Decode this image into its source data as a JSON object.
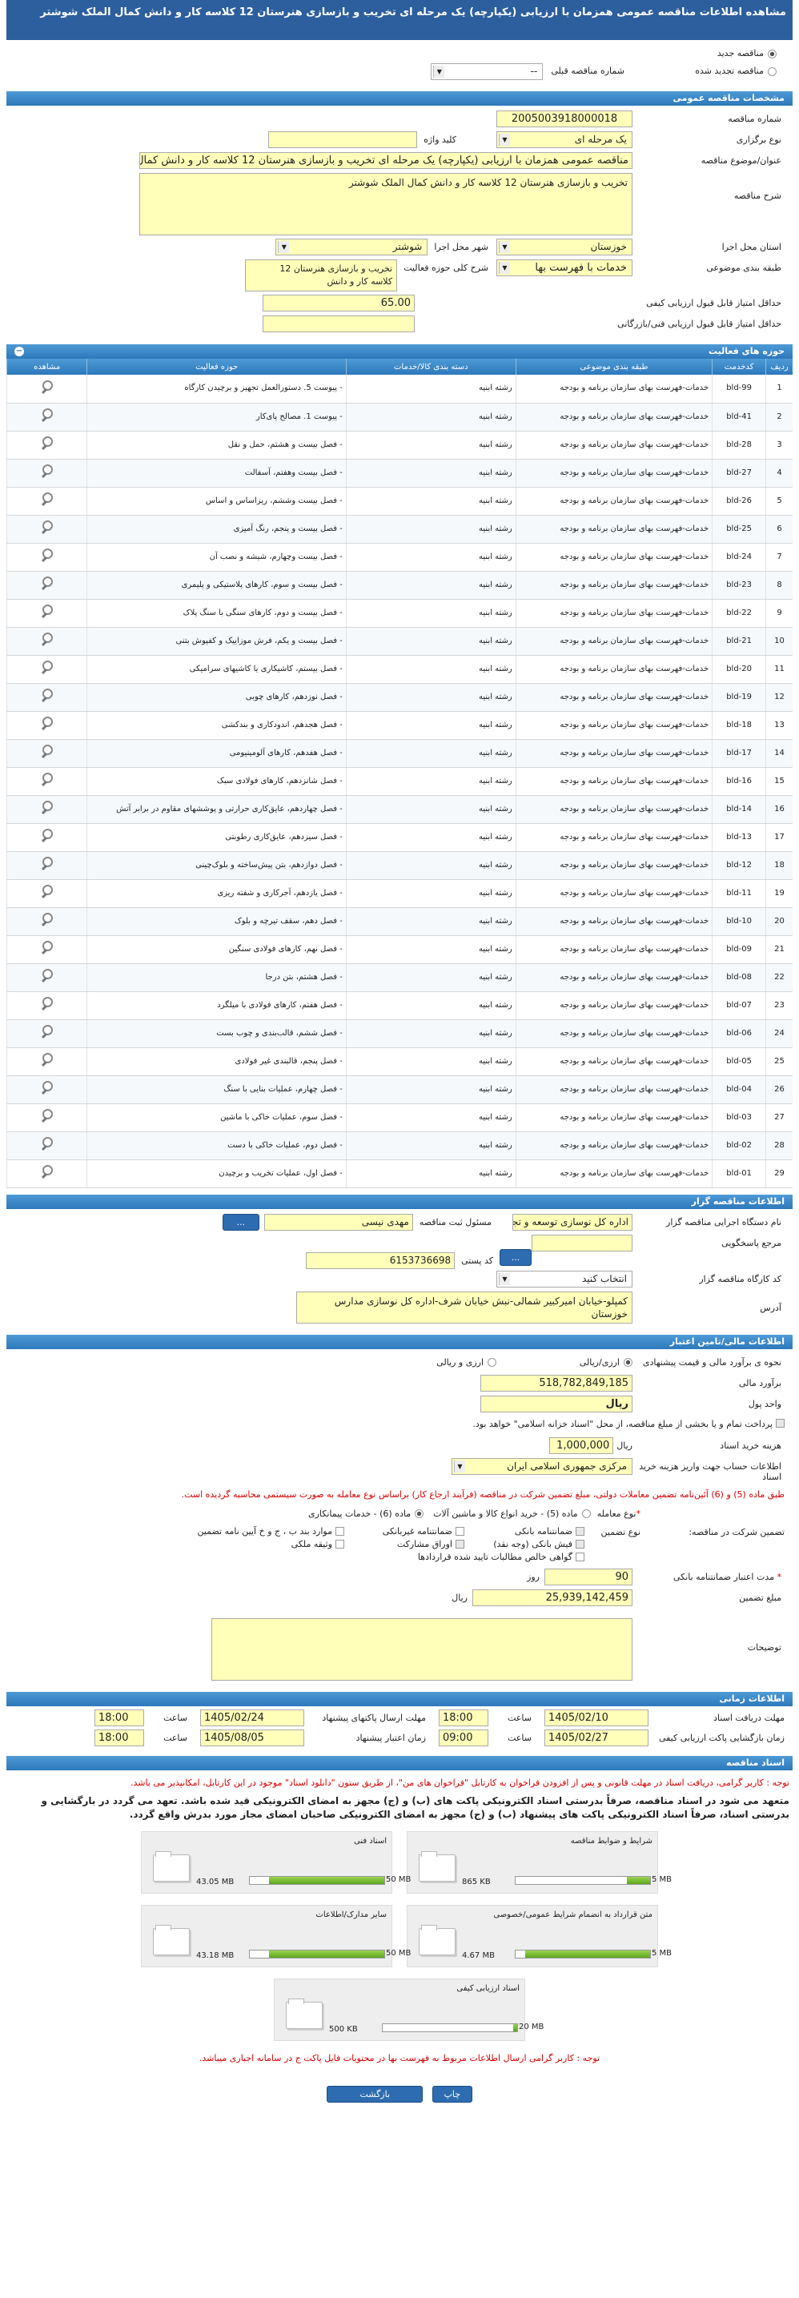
{
  "title": "مشاهده اطلاعات مناقصه عمومی همزمان با ارزیابی (یکپارچه) یک مرحله ای تخریب و بازسازی هنرستان 12 کلاسه کار و دانش کمال الملک شوشتر",
  "tender_kind": {
    "new": "مناقصه جدید",
    "renewed": "مناقصه تجدید شده",
    "prev_label": "شماره مناقصه قبلی",
    "prev_value": "--"
  },
  "spec": {
    "section": "مشخصات مناقصه عمومی",
    "number_label": "شماره مناقصه",
    "number": "2005003918000018",
    "type_label": "نوع برگزاری",
    "type": "یک مرحله ای",
    "keyword_label": "کلید واژه",
    "subject_label": "عنوان/موضوع مناقصه",
    "subject": "مناقصه عمومی همزمان با ارزیابی (یکپارچه) یک مرحله ای تخریب و بازسازی هنرستان 12 کلاسه کار و دانش کمال الملک شوشتر",
    "desc_label": "شرح مناقصه",
    "desc": "تخریب و بازسازی هنرستان 12 کلاسه کار و دانش کمال الملک شوشتر",
    "province_label": "استان محل اجرا",
    "province": "خوزستان",
    "city_label": "شهر محل اجرا",
    "city": "شوشتر",
    "cat_label": "طبقه بندی موضوعی",
    "cat": "خدمات با فهرست بها",
    "scope_label": "شرح کلی حوزه فعالیت",
    "scope": "تخریب و بازسازی هنرستان 12 کلاسه کار و دانش",
    "quality_label": "حداقل امتیاز قابل قبول ارزیابی کیفی",
    "quality": "65.00",
    "tech_label": "حداقل امتیاز قابل قبول ارزیابی فنی/بازرگانی"
  },
  "activity": {
    "section": "حوزه های فعالیت",
    "headers": [
      "ردیف",
      "کدخدمت",
      "طبقه بندی موضوعی",
      "دسته بندی کالا/خدمات",
      "حوزه فعالیت",
      "مشاهده"
    ],
    "rows": [
      [
        "1",
        "bld-99",
        "خدمات-فهرست بهای سازمان برنامه و بودجه",
        "رشته ابنیه",
        "- پیوست 5. دستورالعمل تجهیز و برچیدن کارگاه"
      ],
      [
        "2",
        "bld-41",
        "خدمات-فهرست بهای سازمان برنامه و بودجه",
        "رشته ابنیه",
        "- پیوست 1. مصالح پای‌کار"
      ],
      [
        "3",
        "bld-28",
        "خدمات-فهرست بهای سازمان برنامه و بودجه",
        "رشته ابنیه",
        "- فصل بیست و هشتم، حمل و نقل"
      ],
      [
        "4",
        "bld-27",
        "خدمات-فهرست بهای سازمان برنامه و بودجه",
        "رشته ابنیه",
        "- فصل بیست وهفتم، آسفالت"
      ],
      [
        "5",
        "bld-26",
        "خدمات-فهرست بهای سازمان برنامه و بودجه",
        "رشته ابنیه",
        "- فصل بیست وششم، ریزاساس و اساس"
      ],
      [
        "6",
        "bld-25",
        "خدمات-فهرست بهای سازمان برنامه و بودجه",
        "رشته ابنیه",
        "- فصل بیست و پنجم، رنگ آمیزی"
      ],
      [
        "7",
        "bld-24",
        "خدمات-فهرست بهای سازمان برنامه و بودجه",
        "رشته ابنیه",
        "- فصل بیست وچهارم، شیشه و نصب آن"
      ],
      [
        "8",
        "bld-23",
        "خدمات-فهرست بهای سازمان برنامه و بودجه",
        "رشته ابنیه",
        "- فصل بیست و سوم، کارهای پلاستیکی و پلیمری"
      ],
      [
        "9",
        "bld-22",
        "خدمات-فهرست بهای سازمان برنامه و بودجه",
        "رشته ابنیه",
        "- فصل بیست و دوم، کارهای سنگی با سنگ پلاک"
      ],
      [
        "10",
        "bld-21",
        "خدمات-فهرست بهای سازمان برنامه و بودجه",
        "رشته ابنیه",
        "- فصل بیست و یکم، فرش موزاییک و کفپوش بتنی"
      ],
      [
        "11",
        "bld-20",
        "خدمات-فهرست بهای سازمان برنامه و بودجه",
        "رشته ابنیه",
        "- فصل بیستم، کاشیکاری یا کاشیهای سرامیکی"
      ],
      [
        "12",
        "bld-19",
        "خدمات-فهرست بهای سازمان برنامه و بودجه",
        "رشته ابنیه",
        "- فصل نوزدهم، کارهای چوبی"
      ],
      [
        "13",
        "bld-18",
        "خدمات-فهرست بهای سازمان برنامه و بودجه",
        "رشته ابنیه",
        "- فصل هجدهم، اندودکاری و بندکشی"
      ],
      [
        "14",
        "bld-17",
        "خدمات-فهرست بهای سازمان برنامه و بودجه",
        "رشته ابنیه",
        "- فصل هفدهم، کارهای آلومینیومی"
      ],
      [
        "15",
        "bld-16",
        "خدمات-فهرست بهای سازمان برنامه و بودجه",
        "رشته ابنیه",
        "- فصل شانزدهم، کارهای فولادی سبک"
      ],
      [
        "16",
        "bld-14",
        "خدمات-فهرست بهای سازمان برنامه و بودجه",
        "رشته ابنیه",
        "- فصل چهاردهم، عایق‌کاری حرارتی و پوششهای مقاوم در برابر آتش"
      ],
      [
        "17",
        "bld-13",
        "خدمات-فهرست بهای سازمان برنامه و بودجه",
        "رشته ابنیه",
        "- فصل سیزدهم، عایق‌کاری رطوبتی"
      ],
      [
        "18",
        "bld-12",
        "خدمات-فهرست بهای سازمان برنامه و بودجه",
        "رشته ابنیه",
        "- فصل دوازدهم، بتن پیش‌ساخته و بلوک‌چینی"
      ],
      [
        "19",
        "bld-11",
        "خدمات-فهرست بهای سازمان برنامه و بودجه",
        "رشته ابنیه",
        "- فصل یازدهم، آجرکاری و شفته ریزی"
      ],
      [
        "20",
        "bld-10",
        "خدمات-فهرست بهای سازمان برنامه و بودجه",
        "رشته ابنیه",
        "- فصل دهم، سقف تیرچه و بلوک"
      ],
      [
        "21",
        "bld-09",
        "خدمات-فهرست بهای سازمان برنامه و بودجه",
        "رشته ابنیه",
        "- فصل نهم، کارهای فولادی سنگین"
      ],
      [
        "22",
        "bld-08",
        "خدمات-فهرست بهای سازمان برنامه و بودجه",
        "رشته ابنیه",
        "- فصل هشتم، بتن درجا"
      ],
      [
        "23",
        "bld-07",
        "خدمات-فهرست بهای سازمان برنامه و بودجه",
        "رشته ابنیه",
        "- فصل هفتم، کارهای فولادی با میلگرد"
      ],
      [
        "24",
        "bld-06",
        "خدمات-فهرست بهای سازمان برنامه و بودجه",
        "رشته ابنیه",
        "- فصل ششم، قالب‌بندی و چوب بست"
      ],
      [
        "25",
        "bld-05",
        "خدمات-فهرست بهای سازمان برنامه و بودجه",
        "رشته ابنیه",
        "- فصل پنجم، قالبندی غیر فولادی"
      ],
      [
        "26",
        "bld-04",
        "خدمات-فهرست بهای سازمان برنامه و بودجه",
        "رشته ابنیه",
        "- فصل چهارم، عملیات بنایی با سنگ"
      ],
      [
        "27",
        "bld-03",
        "خدمات-فهرست بهای سازمان برنامه و بودجه",
        "رشته ابنیه",
        "- فصل سوم، عملیات خاکی با ماشین"
      ],
      [
        "28",
        "bld-02",
        "خدمات-فهرست بهای سازمان برنامه و بودجه",
        "رشته ابنیه",
        "- فصل دوم، عملیات خاکی با دست"
      ],
      [
        "29",
        "bld-01",
        "خدمات-فهرست بهای سازمان برنامه و بودجه",
        "رشته ابنیه",
        "- فصل اول، عملیات تخریب و برچیدن"
      ]
    ]
  },
  "org": {
    "section": "اطلاعات مناقصه گزار",
    "exec_label": "نام دستگاه اجرایی مناقصه گزار",
    "exec": "اداره کل نوسازی  توسعه و تجهیز مدارس استان خوزستان",
    "reg_label": "مسئول ثبت مناقصه",
    "reg": "مهدی نیسی",
    "more": "...",
    "ref_label": "مرجع پاسخگویی",
    "postal_label": "کد پستی",
    "postal": "6153736698",
    "workshop_label": "کد کارگاه مناقصه گزار",
    "workshop": "انتخاب کنید",
    "addr_label": "آدرس",
    "addr": "کمپلو-خیابان امیرکبیر شمالی-نبش خیابان شرف-اداره کل نوسازی مدارس خوزستان"
  },
  "fin": {
    "section": "اطلاعات مالی/تامین اعتبار",
    "estimate_label": "نحوه ی برآورد مالی و قیمت پیشنهادی",
    "opt1": "ارزی/ریالی",
    "opt2": "ارزی و ریالی",
    "amount_label": "برآورد مالی",
    "amount": "518,782,849,185",
    "unit_label": "واحد پول",
    "unit": "ریال",
    "treasury": "پرداخت تمام و یا بخشی از مبلغ مناقصه، از محل \"اسناد خزانه اسلامی\" خواهد بود.",
    "docfee_label": "هزینه خرید اسناد",
    "docfee": "1,000,000",
    "docfee_unit": "ریال",
    "acct_label": "اطلاعات حساب جهت واریز هزینه خرید اسناد",
    "acct": "مرکزی جمهوری اسلامی ایران",
    "red_note": "طبق ماده (5) و (6) آئین‌نامه تضمین معاملات دولتی، مبلغ تضمین شرکت در مناقصه (فرآیند ارجاع کار) براساس نوع معامله به صورت سیستمی محاسبه گردیده است.",
    "deal_label": "نوع معامله",
    "deal1": "ماده (5) - خرید انواع کالا و ماشین آلات",
    "deal2": "ماده (6) - خدمات پیمانکاری",
    "gtype_label": "نوع تضمین",
    "gtype_label2": "تضمین شرکت در مناقصه:",
    "g": [
      "ضمانتنامه بانکی",
      "ضمانتنامه غیربانکی",
      "موارد بند ب ، ج و خ آیین نامه تضمین",
      "فیش بانکی (وجه نقد)",
      "اوراق مشارکت",
      "وثیقه ملکی",
      "گواهی خالص مطالبات تایید شده قراردادها"
    ],
    "valid_label": "مدت اعتبار ضمانتنامه بانکی",
    "valid": "90",
    "valid_unit": "روز",
    "gamount_label": "مبلغ تضمین",
    "gamount": "25,939,142,459",
    "gamount_unit": "ریال",
    "notes_label": "توضیحات"
  },
  "times": {
    "section": "اطلاعات زمانی",
    "recv_label": "مهلت دریافت اسناد",
    "recv_date": "1405/02/10",
    "recv_time": "18:00",
    "send_label": "مهلت ارسال پاکتهای پیشنهاد",
    "send_date": "1405/02/24",
    "send_time": "18:00",
    "open_label": "زمان بازگشایی پاکت ارزیابی کیفی",
    "open_date": "1405/02/27",
    "open_time": "09:00",
    "validity_label": "زمان اعتبار پیشنهاد",
    "validity_date": "1405/08/05",
    "validity_time": "18:00",
    "time_label": "ساعت"
  },
  "docs": {
    "section": "اسناد مناقصه",
    "note1": "توجه : کاربر گرامی، دریافت اسناد در مهلت قانونی و پس از افزودن فراخوان به کارتابل \"فراخوان های من\"، از طریق ستون \"دانلود اسناد\" موجود در این کارتابل، امکانپذیر می باشد.",
    "warn": "متعهد می شود در اسناد مناقصه، صرفاً بدرستی اسناد الکترونیکی پاکت های (ب) و (ج) مجهز به امضای الکترونیکی قید شده باشد. تعهد می گردد در بارگشایی و بدرستی اسناد، صرفاً اسناد الکترونیکی پاکت های پیشنهاد (ب) و (ج) مجهز به امضای الکترونیکی صاحبان امضای مجاز مورد بدرش واقع گردد.",
    "tiles": [
      {
        "title": "شرایط و ضوابط مناقصه",
        "max": "5 MB",
        "used": "865 KB",
        "pct": 17
      },
      {
        "title": "اسناد فنی",
        "max": "50 MB",
        "used": "43.05 MB",
        "pct": 86
      },
      {
        "title": "متن قرارداد به انضمام شرایط عمومی/خصوصی",
        "max": "5 MB",
        "used": "4.67 MB",
        "pct": 93
      },
      {
        "title": "سایر مدارک/اطلاعات",
        "max": "50 MB",
        "used": "43.18 MB",
        "pct": 86
      },
      {
        "title": "اسناد ارزیابی کیفی",
        "max": "20 MB",
        "used": "500 KB",
        "pct": 3
      }
    ],
    "note2": "توجه : کاربر گرامی ارسال اطلاعات مربوط به فهرست بها در محتویات فایل پاکت ج در سامانه اجباری میباشد."
  },
  "buttons": {
    "print": "چاپ",
    "back": "بازگشت"
  }
}
